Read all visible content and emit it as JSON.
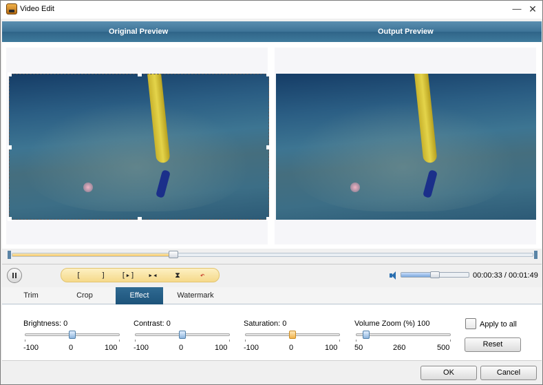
{
  "window": {
    "title": "Video Edit",
    "minimize_label": "—",
    "close_label": "✕"
  },
  "preview": {
    "original_label": "Original Preview",
    "output_label": "Output Preview"
  },
  "timeline": {
    "position_fraction": 0.31
  },
  "toolbar": {
    "tools": [
      {
        "icon": "set-start-icon",
        "glyph": "["
      },
      {
        "icon": "set-end-icon",
        "glyph": "]"
      },
      {
        "icon": "play-segment-icon",
        "glyph": "[▸]"
      },
      {
        "icon": "split-icon",
        "glyph": "▸◂"
      },
      {
        "icon": "merge-icon",
        "glyph": "⧗"
      },
      {
        "icon": "undo-icon",
        "glyph": "↶"
      }
    ]
  },
  "volume": {
    "level_fraction": 0.5
  },
  "time": {
    "display": "00:00:33 / 00:01:49"
  },
  "tabs": [
    {
      "label": "Trim",
      "active": false
    },
    {
      "label": "Crop",
      "active": false
    },
    {
      "label": "Effect",
      "active": true
    },
    {
      "label": "Watermark",
      "active": false
    }
  ],
  "effects": {
    "brightness": {
      "label": "Brightness:",
      "value": "0",
      "min": "-100",
      "mid": "0",
      "max": "100",
      "fraction": 0.5
    },
    "contrast": {
      "label": "Contrast:",
      "value": "0",
      "min": "-100",
      "mid": "0",
      "max": "100",
      "fraction": 0.5
    },
    "saturation": {
      "label": "Saturation:",
      "value": "0",
      "min": "-100",
      "mid": "0",
      "max": "100",
      "fraction": 0.5
    },
    "volume_zoom": {
      "label": "Volume Zoom (%)",
      "value": "100",
      "min": "50",
      "mid": "260",
      "max": "500",
      "fraction": 0.1
    }
  },
  "apply_all": {
    "label": "Apply to all",
    "checked": false
  },
  "buttons": {
    "reset": "Reset",
    "ok": "OK",
    "cancel": "Cancel"
  },
  "colors": {
    "header_band": "#3d7397",
    "active_tab": "#1d537a",
    "timeline_fill": "#f0c56a",
    "saturation_thumb": "#f1b34c"
  }
}
